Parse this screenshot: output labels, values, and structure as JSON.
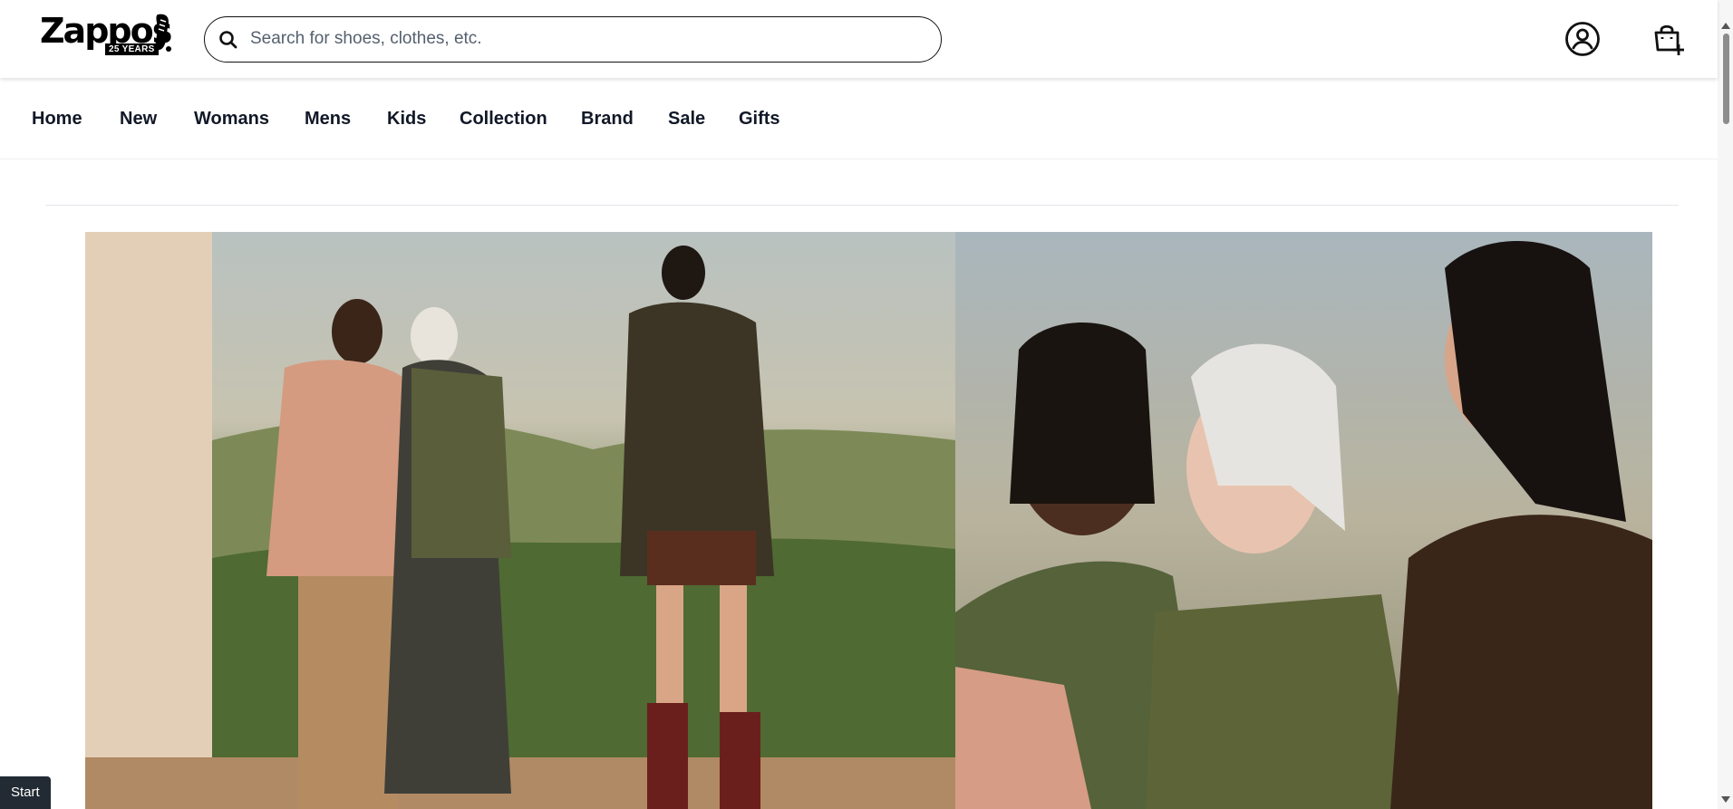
{
  "brand": {
    "logo_text": "Zappos",
    "logo_badge": "25 YEARS"
  },
  "search": {
    "placeholder": "Search for shoes, clothes, etc.",
    "value": ""
  },
  "header_icons": {
    "account": "account-icon",
    "cart": "shopping-bag-add-icon",
    "search": "search-icon"
  },
  "nav": {
    "items": [
      {
        "label": "Home"
      },
      {
        "label": "New"
      },
      {
        "label": "Womans"
      },
      {
        "label": "Mens"
      },
      {
        "label": "Kids"
      },
      {
        "label": "Collection"
      },
      {
        "label": "Brand"
      },
      {
        "label": "Sale"
      },
      {
        "label": "Gifts"
      }
    ]
  },
  "hero": {
    "image_description": "Fashion campaign photo of three women in autumn jackets"
  },
  "start_button": {
    "label": "Start"
  },
  "colors": {
    "text": "#111827",
    "start_bg": "#222b33",
    "divider": "#e5e7eb"
  }
}
